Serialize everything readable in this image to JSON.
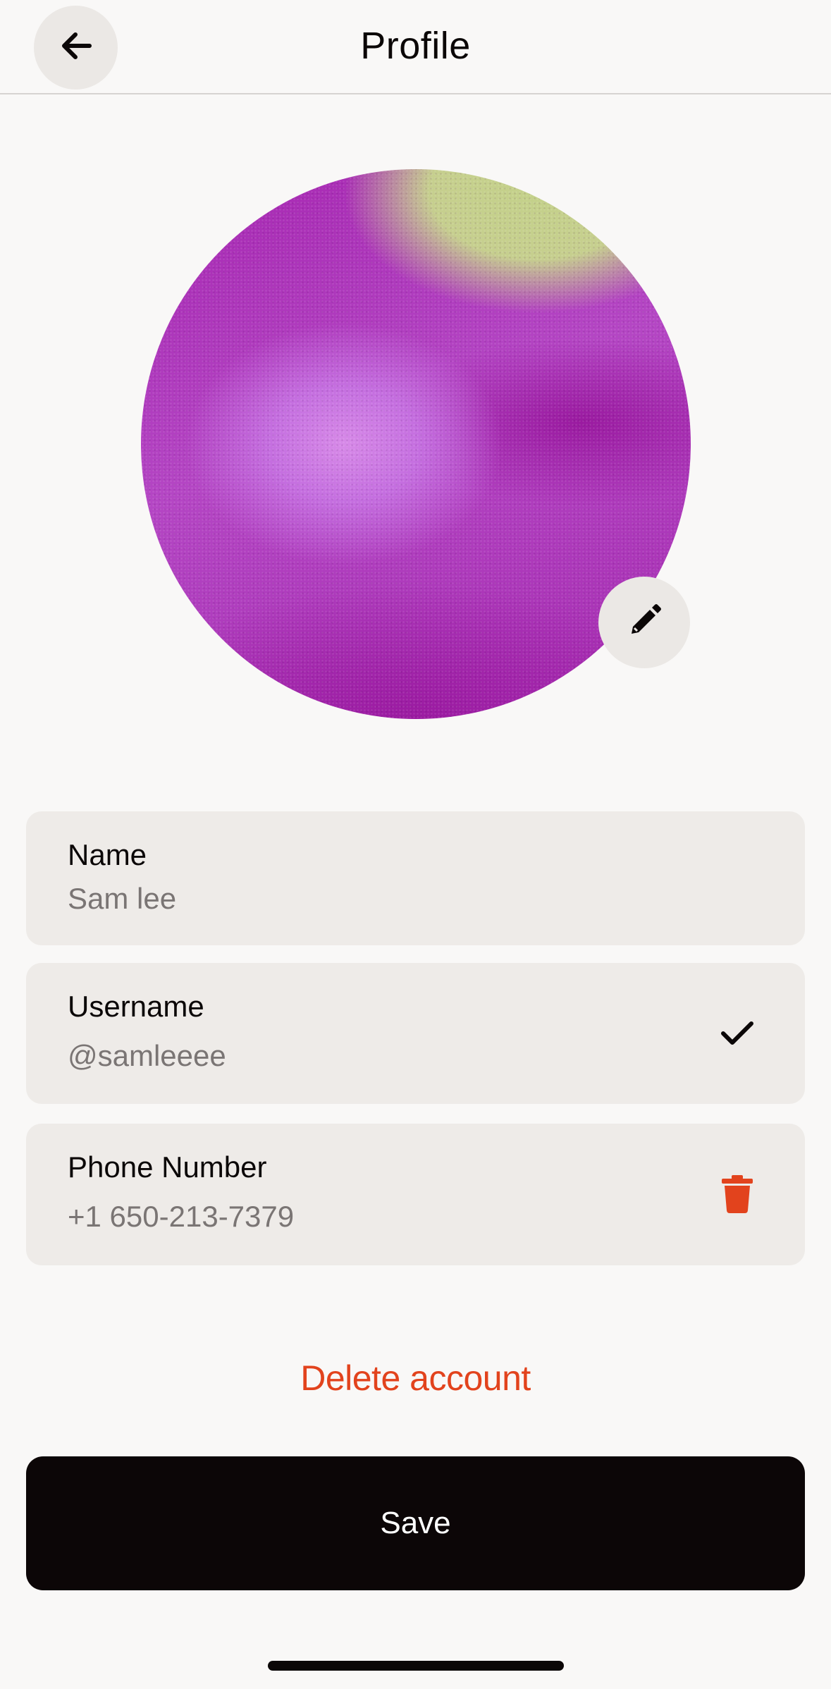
{
  "header": {
    "title": "Profile",
    "back_icon": "arrow-left-icon"
  },
  "avatar": {
    "edit_icon": "pencil-icon"
  },
  "fields": {
    "name": {
      "label": "Name",
      "value": "Sam lee"
    },
    "username": {
      "label": "Username",
      "value": "@samleeee",
      "status_icon": "check-icon"
    },
    "phone": {
      "label": "Phone Number",
      "value": "+1 650-213-7379",
      "action_icon": "trash-icon"
    }
  },
  "actions": {
    "delete_account": "Delete account",
    "save": "Save"
  },
  "colors": {
    "background": "#f9f8f7",
    "card": "#eeebe8",
    "danger": "#e2431d",
    "primary_button": "#0c0607"
  }
}
